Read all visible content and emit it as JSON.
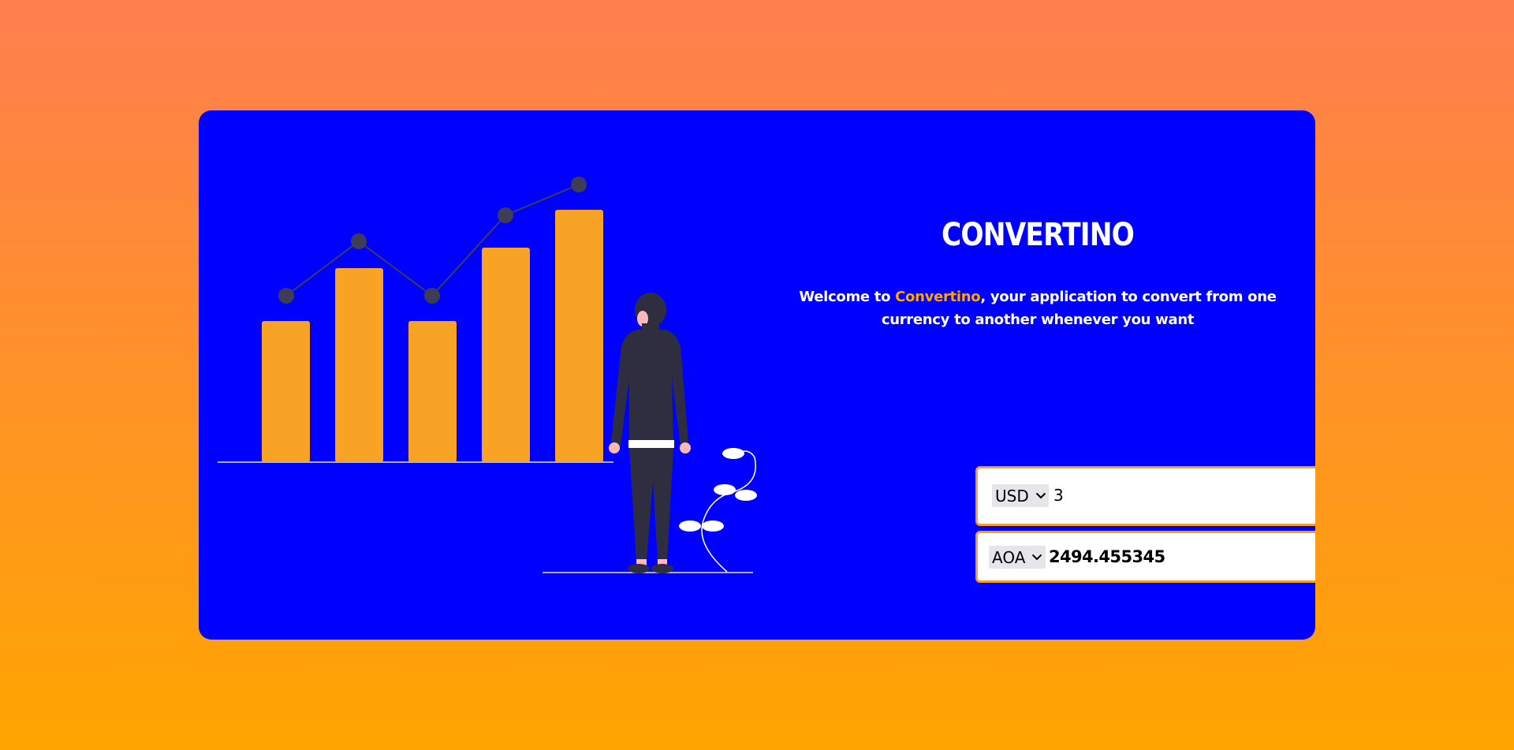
{
  "app": {
    "title": "CONVERTINO",
    "welcome_prefix": "Welcome to ",
    "welcome_brand": "Convertino",
    "welcome_suffix": ", your application to convert from one currency to another whenever you want"
  },
  "converter": {
    "from": {
      "currency": "USD",
      "amount": "3"
    },
    "to": {
      "currency": "AOA",
      "amount": "2494.455345"
    }
  },
  "colors": {
    "background_top": "#ff7f50",
    "background_bottom": "#ffa500",
    "card": "#0000fe",
    "accent": "#ffa500",
    "bars": "#f9a326",
    "figure": "#2f2e41"
  },
  "icons": {
    "select_arrow": "chevron-down-icon",
    "spinner": "up-down-arrows-icon"
  }
}
